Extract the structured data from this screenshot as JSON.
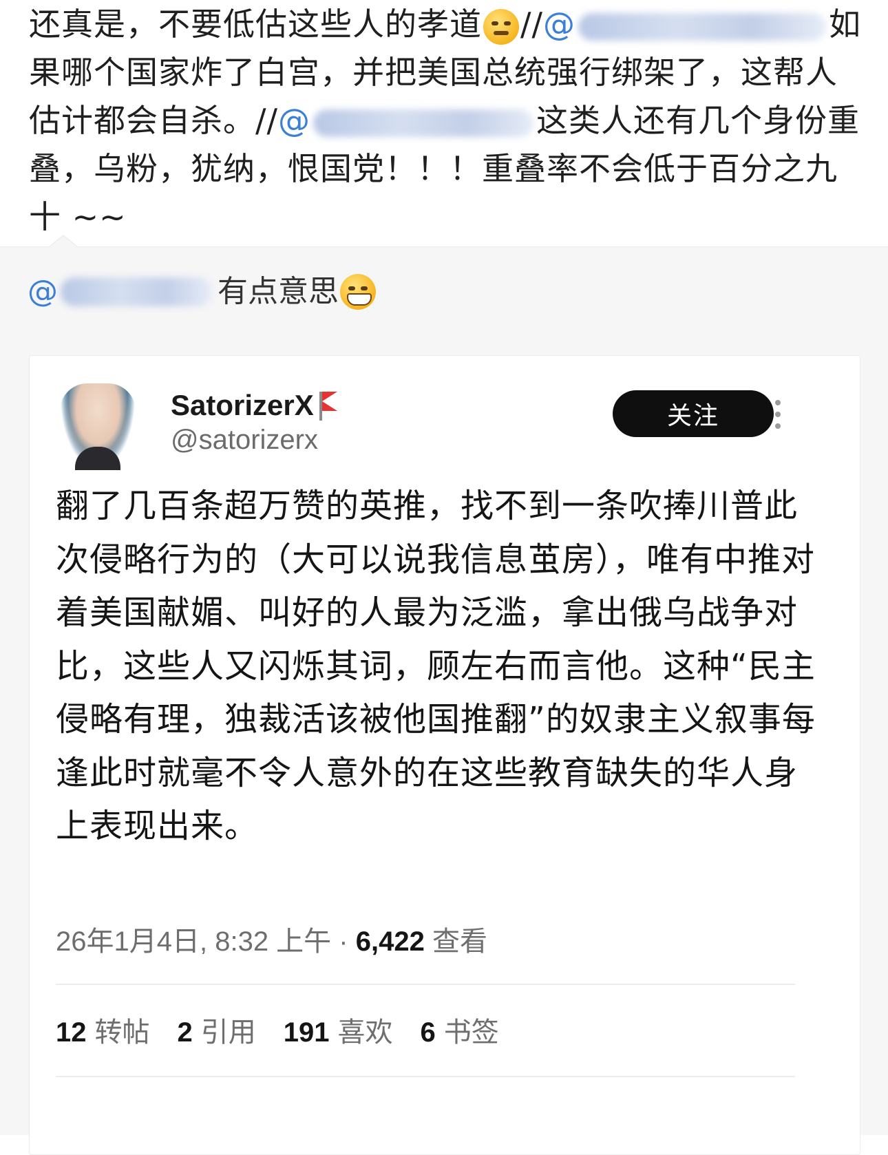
{
  "top_post": {
    "seg1": "还真是，不要低估这些人的孝道",
    "sep1": "//",
    "at1": "@",
    "line2": "如果哪个国家炸了白宫，并把美国总统强行绑架了，这帮人估计都会自杀。",
    "sep2": "//",
    "at2": "@",
    "line3": "这类人还有几个身份重叠，乌粉，犹纳，恨国党！！！重叠率不会低于百分之九十 ~~"
  },
  "reply": {
    "at": "@",
    "text": "有点意思"
  },
  "tweet": {
    "display_name": "SatorizerX",
    "handle": "@satorizerx",
    "follow_label": "关注",
    "body": "翻了几百条超万赞的英推，找不到一条吹捧川普此次侵略行为的（大可以说我信息茧房），唯有中推对着美国献媚、叫好的人最为泛滥，拿出俄乌战争对比，这些人又闪烁其词，顾左右而言他。这种“民主侵略有理，独裁活该被他国推翻”的奴隶主义叙事每逢此时就毫不令人意外的在这些教育缺失的华人身上表现出来。",
    "timestamp": "26年1月4日, 8:32 上午",
    "dot": " · ",
    "views_count": "6,422",
    "views_label": "查看",
    "stats": [
      {
        "num": "12",
        "label": "转帖"
      },
      {
        "num": "2",
        "label": "引用"
      },
      {
        "num": "191",
        "label": "喜欢"
      },
      {
        "num": "6",
        "label": "书签"
      }
    ]
  },
  "icons": {
    "emoji_1": "face-with-monocle-thinking-emoji",
    "emoji_2": "grinning-face-emoji",
    "flag": "red-flag-icon",
    "more": "more-vertical-icon"
  },
  "colors": {
    "mention": "#3b7fd6",
    "follow_bg": "#0f0f0f",
    "flag": "#e53232"
  }
}
